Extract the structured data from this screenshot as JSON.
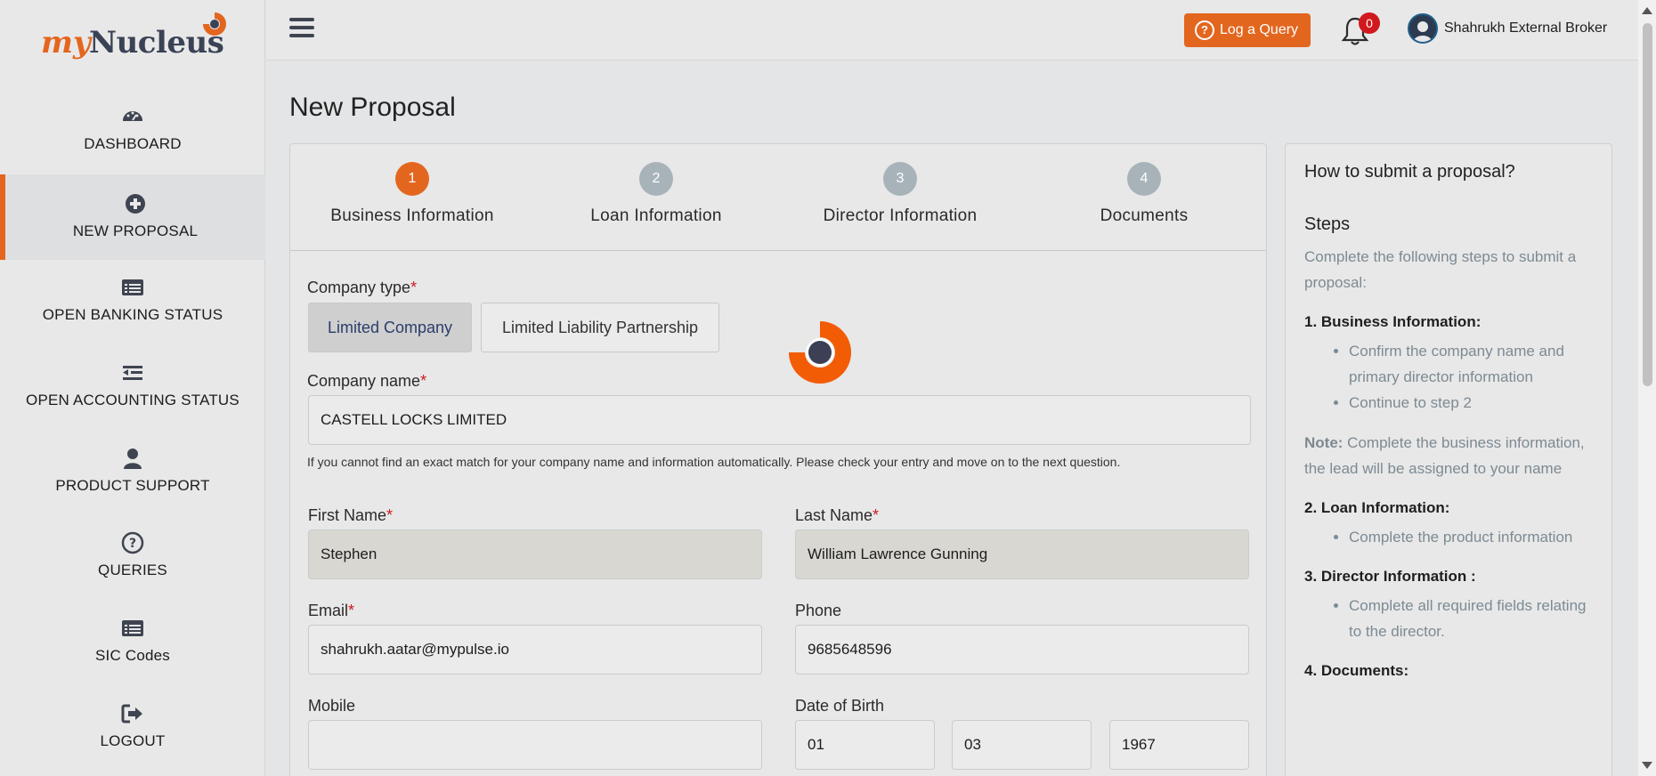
{
  "brand": {
    "logo_my": "my",
    "logo_nucleus": "Nucleus"
  },
  "sidebar": {
    "items": [
      {
        "label": "DASHBOARD",
        "icon": "dashboard-icon"
      },
      {
        "label": "NEW PROPOSAL",
        "icon": "plus-circle-icon"
      },
      {
        "label": "OPEN BANKING STATUS",
        "icon": "list-alt-icon"
      },
      {
        "label": "OPEN ACCOUNTING STATUS",
        "icon": "indent-icon"
      },
      {
        "label": "PRODUCT SUPPORT",
        "icon": "user-icon"
      },
      {
        "label": "QUERIES",
        "icon": "question-circle-icon"
      },
      {
        "label": "SIC Codes",
        "icon": "list-alt-icon"
      },
      {
        "label": "LOGOUT",
        "icon": "sign-out-icon"
      }
    ]
  },
  "header": {
    "query_button": "Log a Query",
    "notifications_count": "0",
    "user_name": "Shahrukh External Broker"
  },
  "page": {
    "title": "New Proposal"
  },
  "steps": [
    {
      "num": "1",
      "label": "Business Information"
    },
    {
      "num": "2",
      "label": "Loan Information"
    },
    {
      "num": "3",
      "label": "Director Information"
    },
    {
      "num": "4",
      "label": "Documents"
    }
  ],
  "form": {
    "company_type_label": "Company type",
    "company_type_options": [
      "Limited Company",
      "Limited Liability Partnership"
    ],
    "company_name_label": "Company name",
    "company_name_value": "CASTELL LOCKS LIMITED",
    "company_hint": "If you cannot find an exact match for your company name and information automatically. Please check your entry and move on to the next question.",
    "first_name_label": "First Name",
    "first_name_value": "Stephen",
    "last_name_label": "Last Name",
    "last_name_value": "William Lawrence Gunning",
    "email_label": "Email",
    "email_value": "shahrukh.aatar@mypulse.io",
    "phone_label": "Phone",
    "phone_value": "9685648596",
    "mobile_label": "Mobile",
    "mobile_value": "",
    "dob_label": "Date of Birth",
    "dob_day": "01",
    "dob_month": "03",
    "dob_year": "1967",
    "required_mark": "*"
  },
  "help": {
    "title": "How to submit a proposal?",
    "steps_heading": "Steps",
    "intro": "Complete the following steps to submit a proposal:",
    "sec1": "1. Business Information:",
    "sec1_items": [
      "Confirm the company name and primary director information",
      "Continue to step 2"
    ],
    "note_label": "Note:",
    "note_text": " Complete the business information, the lead will be assigned to your name",
    "sec2": "2. Loan Information:",
    "sec2_items": [
      "Complete the product information"
    ],
    "sec3": "3. Director Information :",
    "sec3_items": [
      "Complete all required fields relating to the director."
    ],
    "sec4": "4. Documents:"
  },
  "colors": {
    "accent": "#e3661f",
    "navy": "#3a4256",
    "badge": "#d0191e"
  }
}
